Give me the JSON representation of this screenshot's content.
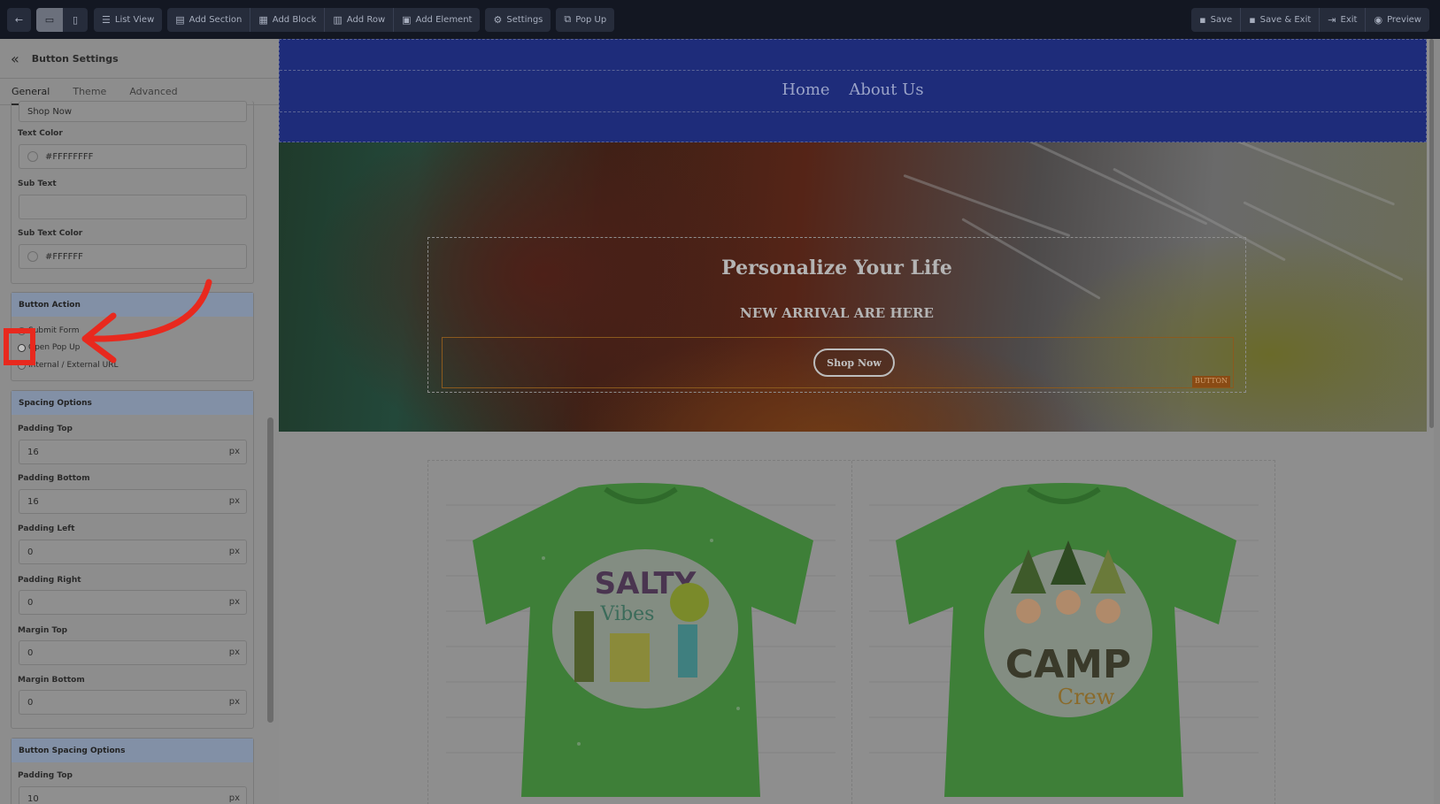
{
  "toolbar": {
    "back_label": "",
    "list_view": "List View",
    "add_section": "Add Section",
    "add_block": "Add Block",
    "add_row": "Add Row",
    "add_element": "Add Element",
    "settings": "Settings",
    "pop_up": "Pop Up",
    "save": "Save",
    "save_exit": "Save & Exit",
    "exit": "Exit",
    "preview": "Preview"
  },
  "panel": {
    "title": "Button Settings",
    "tabs": [
      "General",
      "Theme",
      "Advanced"
    ],
    "button_text_value": "Shop Now",
    "text_color_label": "Text Color",
    "text_color_value": "#FFFFFFFF",
    "sub_text_label": "Sub Text",
    "sub_text_value": "",
    "sub_text_color_label": "Sub Text Color",
    "sub_text_color_value": "#FFFFFF",
    "button_action": {
      "header": "Button Action",
      "options": [
        "Submit Form",
        "Open Pop Up",
        "Internal / External URL"
      ],
      "selected": "Open Pop Up"
    },
    "spacing": {
      "header": "Spacing Options",
      "padding_top_label": "Padding Top",
      "padding_top": "16",
      "padding_bottom_label": "Padding Bottom",
      "padding_bottom": "16",
      "padding_left_label": "Padding Left",
      "padding_left": "0",
      "padding_right_label": "Padding Right",
      "padding_right": "0",
      "margin_top_label": "Margin Top",
      "margin_top": "0",
      "margin_bottom_label": "Margin Bottom",
      "margin_bottom": "0",
      "unit": "px"
    },
    "button_spacing": {
      "header": "Button Spacing Options",
      "padding_top_label": "Padding Top",
      "padding_top": "10",
      "unit": "px"
    }
  },
  "canvas": {
    "nav": [
      "Home",
      "About Us"
    ],
    "hero_title": "Personalize Your Life",
    "hero_sub": "NEW ARRIVAL ARE HERE",
    "hero_button": "Shop Now",
    "button_tag": "BUTTON"
  },
  "colors": {
    "toolbar_bg": "#131722",
    "nav_band": "#1e2c7a",
    "annotation": "#e8291e",
    "shirt_green": "#3e8a3a"
  }
}
